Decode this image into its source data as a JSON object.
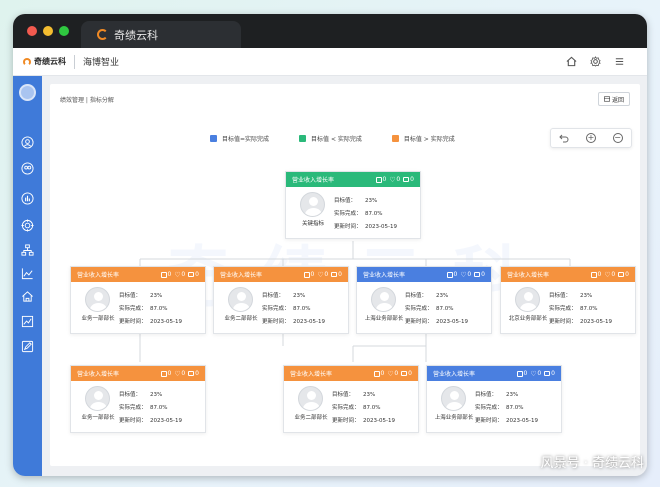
{
  "browser": {
    "tab_title": "奇绩云科",
    "window_controls": [
      "close",
      "minimize",
      "maximize"
    ]
  },
  "app": {
    "logo_text": "奇绩云科",
    "company_name": "海博智业",
    "top_icons": [
      "home-icon",
      "settings-icon",
      "menu-icon"
    ]
  },
  "sidebar": {
    "items": [
      "avatar",
      "user-group-icon",
      "user-card-icon",
      "bar-chart-icon",
      "target-icon",
      "org-chart-icon",
      "line-chart-icon",
      "home-chart-icon",
      "trend-chart-icon",
      "edit-icon"
    ]
  },
  "page": {
    "breadcrumb": "绩效管理 | 指标分解",
    "top_button": "返回"
  },
  "legend": [
    {
      "label": "目标值=实际完成",
      "color": "#4a7fe0"
    },
    {
      "label": "目标值 < 实际完成",
      "color": "#2ab97a"
    },
    {
      "label": "目标值 > 实际完成",
      "color": "#f5923e"
    }
  ],
  "zoom_icons": [
    "undo-icon",
    "zoom-in-icon",
    "zoom-out-icon"
  ],
  "labels": {
    "target": "目标值：",
    "actual": "实际完成：",
    "updated": "更新时间："
  },
  "cards": [
    {
      "title": "营业收入增长率",
      "color": "#2ab97a",
      "dept": "关键指标",
      "target": "23%",
      "actual": "87.0%",
      "updated": "2023-05-19",
      "c1": "0",
      "c2": "0",
      "c3": "0"
    },
    {
      "title": "营业收入增长率",
      "color": "#f5923e",
      "dept": "业务一部部长",
      "target": "23%",
      "actual": "87.0%",
      "updated": "2023-05-19",
      "c1": "0",
      "c2": "0",
      "c3": "0"
    },
    {
      "title": "营业收入增长率",
      "color": "#f5923e",
      "dept": "业务二部部长",
      "target": "23%",
      "actual": "87.0%",
      "updated": "2023-05-19",
      "c1": "0",
      "c2": "0",
      "c3": "0"
    },
    {
      "title": "营业收入增长率",
      "color": "#4a7fe0",
      "dept": "上海业务部部长",
      "target": "23%",
      "actual": "87.0%",
      "updated": "2023-05-19",
      "c1": "0",
      "c2": "0",
      "c3": "0"
    },
    {
      "title": "营业收入增长率",
      "color": "#f5923e",
      "dept": "北京业务部部长",
      "target": "23%",
      "actual": "87.0%",
      "updated": "2023-05-19",
      "c1": "0",
      "c2": "0",
      "c3": "0"
    },
    {
      "title": "营业收入增长率",
      "color": "#f5923e",
      "dept": "业务一部部长",
      "target": "23%",
      "actual": "87.0%",
      "updated": "2023-05-19",
      "c1": "0",
      "c2": "0",
      "c3": "0"
    },
    {
      "title": "营业收入增长率",
      "color": "#f5923e",
      "dept": "业务二部部长",
      "target": "23%",
      "actual": "87.0%",
      "updated": "2023-05-19",
      "c1": "0",
      "c2": "0",
      "c3": "0"
    },
    {
      "title": "营业收入增长率",
      "color": "#4a7fe0",
      "dept": "上海业务部部长",
      "target": "23%",
      "actual": "87.0%",
      "updated": "2023-05-19",
      "c1": "0",
      "c2": "0",
      "c3": "0"
    }
  ],
  "watermark": "奇绩云科",
  "footer_watermark": "风景号 · 奇绩云科"
}
